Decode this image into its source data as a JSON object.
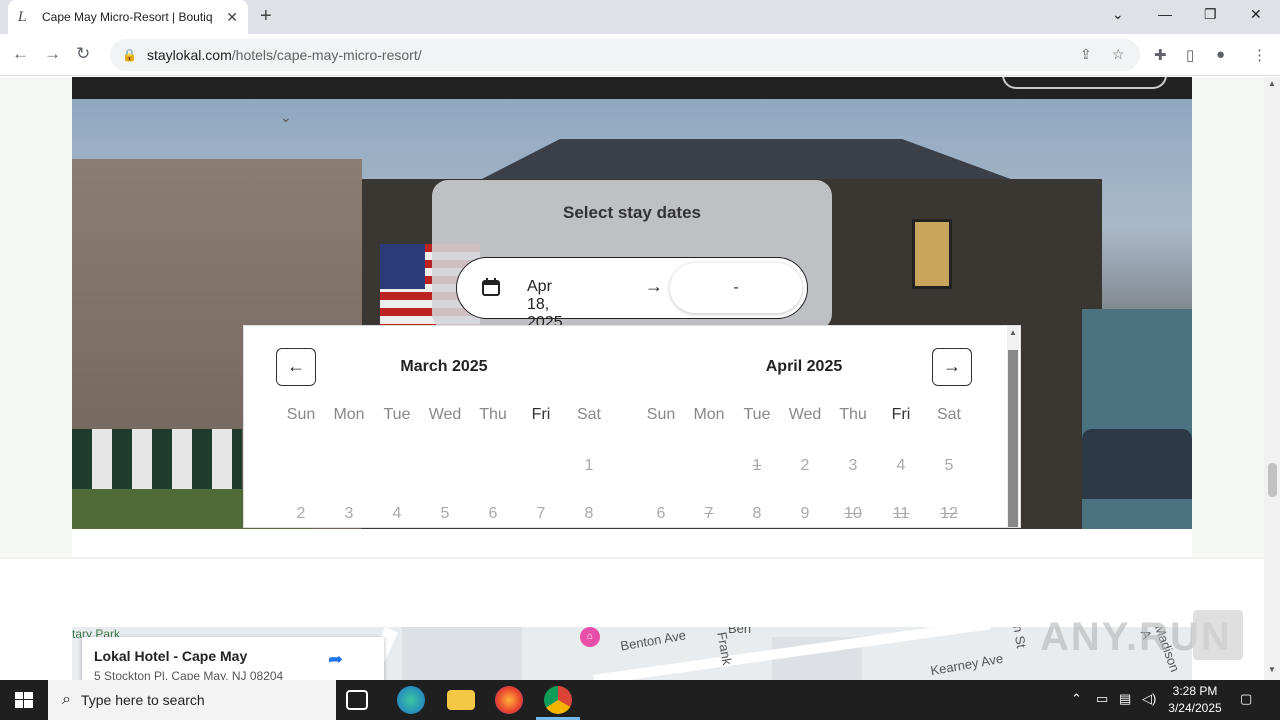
{
  "browser": {
    "tab_title": "Cape May Micro-Resort | Boutiq",
    "favicon_letter": "L",
    "url_host": "staylokal.com",
    "url_path": "/hotels/cape-may-micro-resort/"
  },
  "picker": {
    "title": "Select stay dates",
    "start_date": "Apr 18, 2025",
    "end_date": "-"
  },
  "calendar": {
    "weekdays": [
      "Sun",
      "Mon",
      "Tue",
      "Wed",
      "Thu",
      "Fri",
      "Sat"
    ],
    "months": [
      {
        "title": "March 2025",
        "rows": [
          [
            "",
            "",
            "",
            "",
            "",
            "",
            "1"
          ],
          [
            "2",
            "3",
            "4",
            "5",
            "6",
            "7",
            "8"
          ]
        ],
        "struck": []
      },
      {
        "title": "April 2025",
        "rows": [
          [
            "",
            "",
            "1",
            "2",
            "3",
            "4",
            "5"
          ],
          [
            "6",
            "7",
            "8",
            "9",
            "10",
            "11",
            "12"
          ]
        ],
        "struck": [
          "1",
          "7",
          "10",
          "11",
          "12"
        ]
      }
    ]
  },
  "map": {
    "hotel_name": "Lokal Hotel - Cape May",
    "address": "5 Stockton Pl, Cape May, NJ 08204",
    "directions_label": "Directions",
    "park_label": "tary Park",
    "streets": [
      "Benton Ave",
      "Kearney Ave",
      "Frank",
      "Madison A",
      "n St",
      "Ben"
    ]
  },
  "watermark": "ANY.RUN",
  "taskbar": {
    "search_placeholder": "Type here to search",
    "time": "3:28 PM",
    "date": "3/24/2025"
  }
}
